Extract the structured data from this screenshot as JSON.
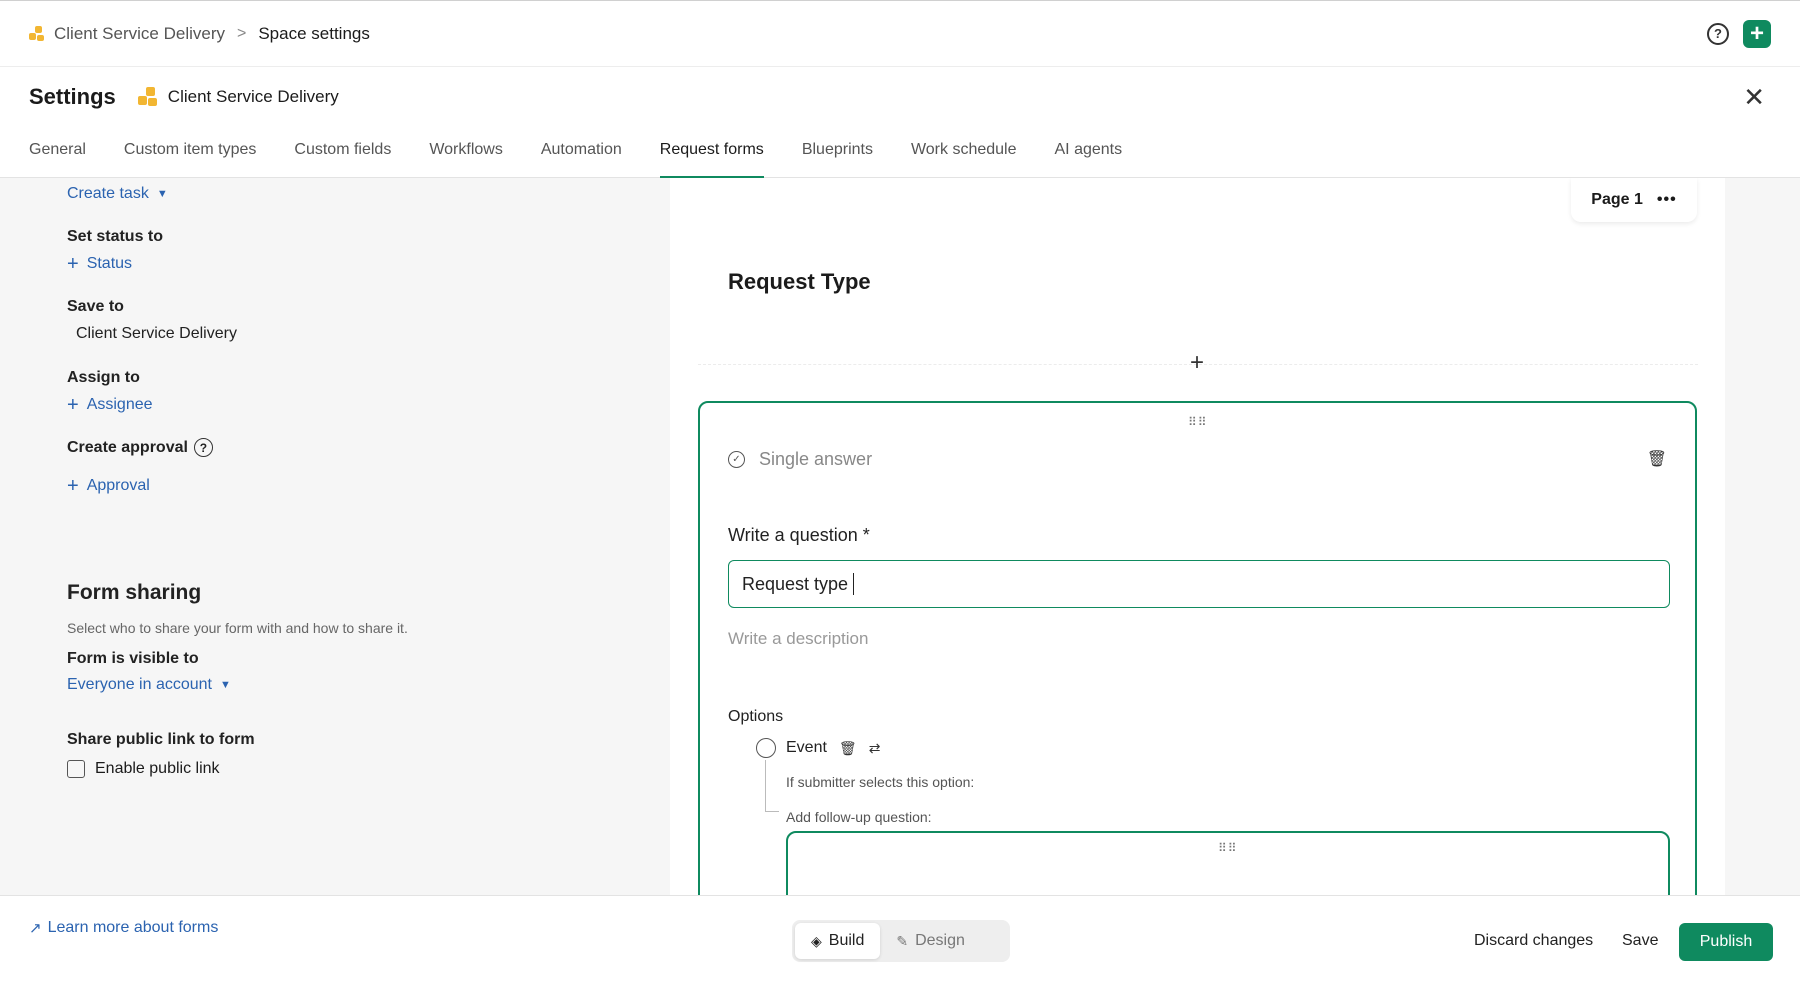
{
  "breadcrumb": {
    "space": "Client Service Delivery",
    "separator": ">",
    "current": "Space settings"
  },
  "topbar": {
    "help_icon": "?",
    "add_icon": "+"
  },
  "header": {
    "title": "Settings",
    "space_name": "Client Service Delivery",
    "close_icon": "✕"
  },
  "tabs": [
    {
      "label": "General"
    },
    {
      "label": "Custom item types"
    },
    {
      "label": "Custom fields"
    },
    {
      "label": "Workflows"
    },
    {
      "label": "Automation"
    },
    {
      "label": "Request forms",
      "active": true
    },
    {
      "label": "Blueprints"
    },
    {
      "label": "Work schedule"
    },
    {
      "label": "AI agents"
    }
  ],
  "left_panel": {
    "create_task": "Create task",
    "set_status_label": "Set status to",
    "status_link": "Status",
    "save_to_label": "Save to",
    "save_to_value": "Client Service Delivery",
    "assign_to_label": "Assign to",
    "assignee_link": "Assignee",
    "create_approval_label": "Create approval",
    "approval_link": "Approval",
    "form_sharing_title": "Form sharing",
    "form_sharing_desc": "Select who to share your form with and how to share it.",
    "visible_to_label": "Form is visible to",
    "visible_to_value": "Everyone in account",
    "public_link_label": "Share public link to form",
    "enable_public_link": "Enable public link"
  },
  "form": {
    "page_label": "Page 1",
    "page_menu": "•••",
    "section_title": "Request Type",
    "add_icon": "+",
    "question": {
      "type": "Single answer",
      "label": "Write a question *",
      "value": "Request type",
      "description_placeholder": "Write a description",
      "options_label": "Options",
      "options": [
        {
          "label": "Event"
        }
      ],
      "if_selected_text": "If submitter selects this option:",
      "followup_text": "Add follow-up question:"
    }
  },
  "bottombar": {
    "learn_more": "Learn more about forms",
    "build": "Build",
    "design": "Design",
    "discard": "Discard changes",
    "save": "Save",
    "publish": "Publish"
  },
  "colors": {
    "accent": "#0f8a5f",
    "link": "#2b63b0",
    "space_icon": "#f2b632"
  }
}
